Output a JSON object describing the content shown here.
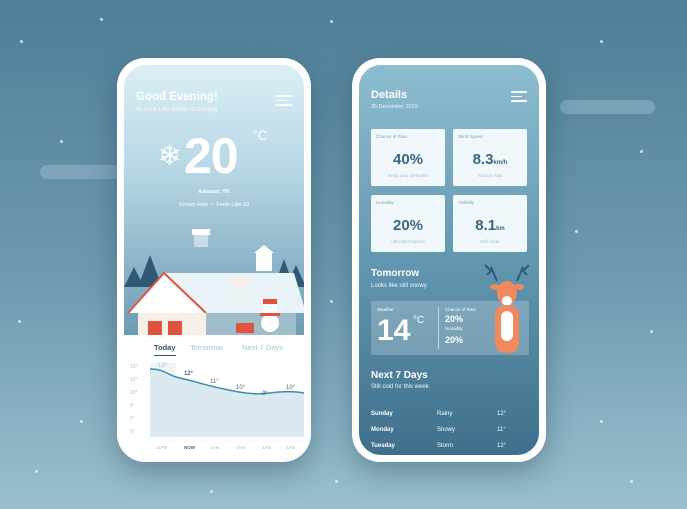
{
  "colors": {
    "accent": "#e0533f",
    "navy": "#2e5672",
    "sky": "#b6d6e4"
  },
  "left_screen": {
    "greeting": "Good Evening!",
    "subtitle": "Its Look Like Winter is Coming",
    "temperature": "20",
    "unit": "°C",
    "weather_icon": "snowflake-icon",
    "location": "Kalasan, YK",
    "condition": "Snowy Rain",
    "separator": "•",
    "feels_like": "Feels Like 10",
    "tabs": [
      "Today",
      "Tomorrow",
      "Next 7 Days"
    ],
    "active_tab": "Today",
    "graph": {
      "y_labels": [
        "15°",
        "12°",
        "10°",
        "8°",
        "5°",
        "0°"
      ],
      "x_labels": [
        "11PM",
        "NOW",
        "1AM",
        "2AM",
        "3AM",
        "5AM"
      ],
      "values": [
        "13°",
        "12°",
        "11°",
        "10°",
        "9°",
        "10°"
      ]
    }
  },
  "right_screen": {
    "title": "Details",
    "date": "25 December 2019",
    "cards": [
      {
        "label": "Chance of Rain",
        "value": "40%",
        "unit": "",
        "note": "Keep your Umbrella"
      },
      {
        "label": "Wind Speed",
        "value": "8.3",
        "unit": "km/h",
        "note": "Not too Fast"
      },
      {
        "label": "Humidity",
        "value": "20%",
        "unit": "",
        "note": "Little Wet Outside"
      },
      {
        "label": "Visibility",
        "value": "8.1",
        "unit": "km",
        "note": "Still Clear"
      }
    ],
    "tomorrow": {
      "title": "Tomorrow",
      "subtitle": "Looks like still snowy",
      "weather_label": "Weather",
      "temperature": "14",
      "unit": "°C",
      "rain_label": "Chance of Rain",
      "rain_value": "20%",
      "humidity_label": "Humidity",
      "humidity_value": "20%"
    },
    "next7": {
      "title": "Next 7 Days",
      "subtitle": "Still cold for this week",
      "rows": [
        {
          "day": "Sunday",
          "cond": "Rainy",
          "temp": "12°"
        },
        {
          "day": "Monday",
          "cond": "Snowy",
          "temp": "11°"
        },
        {
          "day": "Tuesday",
          "cond": "Storm",
          "temp": "12°"
        }
      ]
    }
  }
}
